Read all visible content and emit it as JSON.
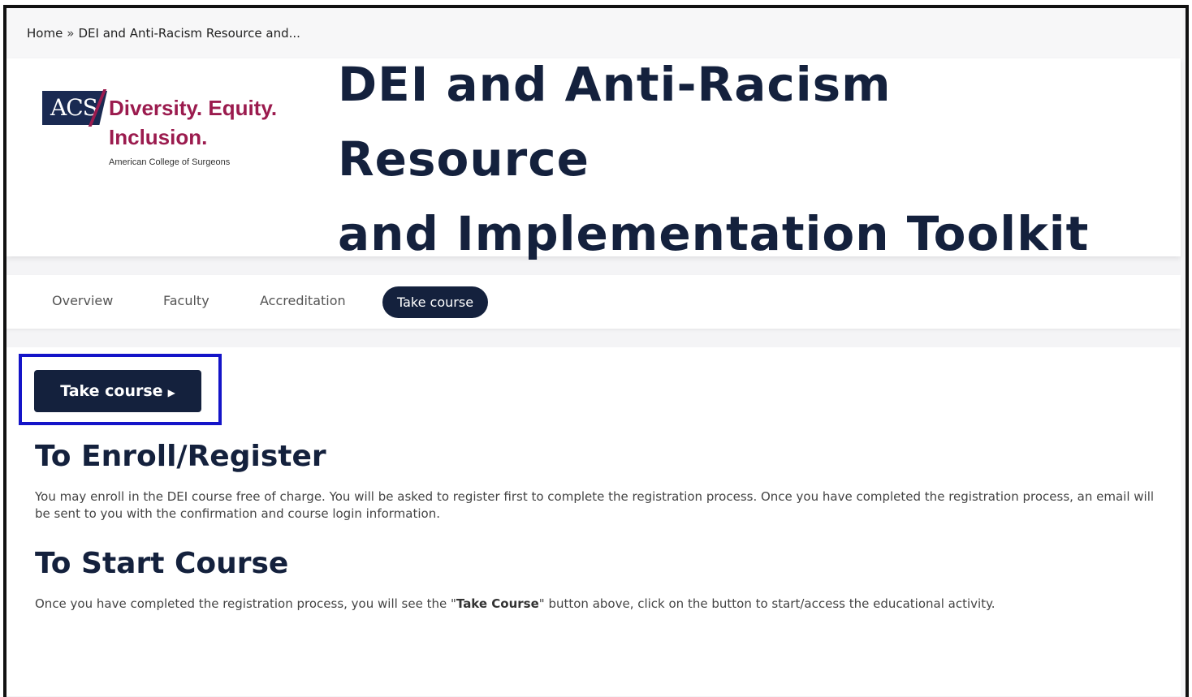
{
  "breadcrumb": {
    "home": "Home",
    "separator": "»",
    "current": "DEI and Anti-Racism Resource and..."
  },
  "logo": {
    "acs": "ACS",
    "tagline_line1": "Diversity. Equity.",
    "tagline_line2": "Inclusion.",
    "org": "American College of Surgeons",
    "brand_color": "#9b1b4e",
    "navy_color": "#1a2a52"
  },
  "hero": {
    "title_line1": "DEI and Anti-Racism Resource",
    "title_line2": "and Implementation Toolkit"
  },
  "tabs": [
    {
      "label": "Overview",
      "active": false
    },
    {
      "label": "Faculty",
      "active": false
    },
    {
      "label": "Accreditation",
      "active": false
    },
    {
      "label": "Take course",
      "active": true
    }
  ],
  "content": {
    "take_button_label": "Take course",
    "arrow_icon": "caret-right-icon",
    "enroll_heading": "To Enroll/Register",
    "enroll_text": "You may enroll in the DEI course free of charge. You will be asked to register first to complete the registration process. Once you have completed the registration process, an email will be sent to you with the confirmation and course login information.",
    "start_heading": "To Start Course",
    "start_text_before": "Once you have completed the registration process, you will see the \"",
    "start_text_bold": "Take Course",
    "start_text_after": "\" button above, click on the button to start/access the educational activity."
  },
  "colors": {
    "primary": "#14213d",
    "highlight": "#1414c8"
  }
}
